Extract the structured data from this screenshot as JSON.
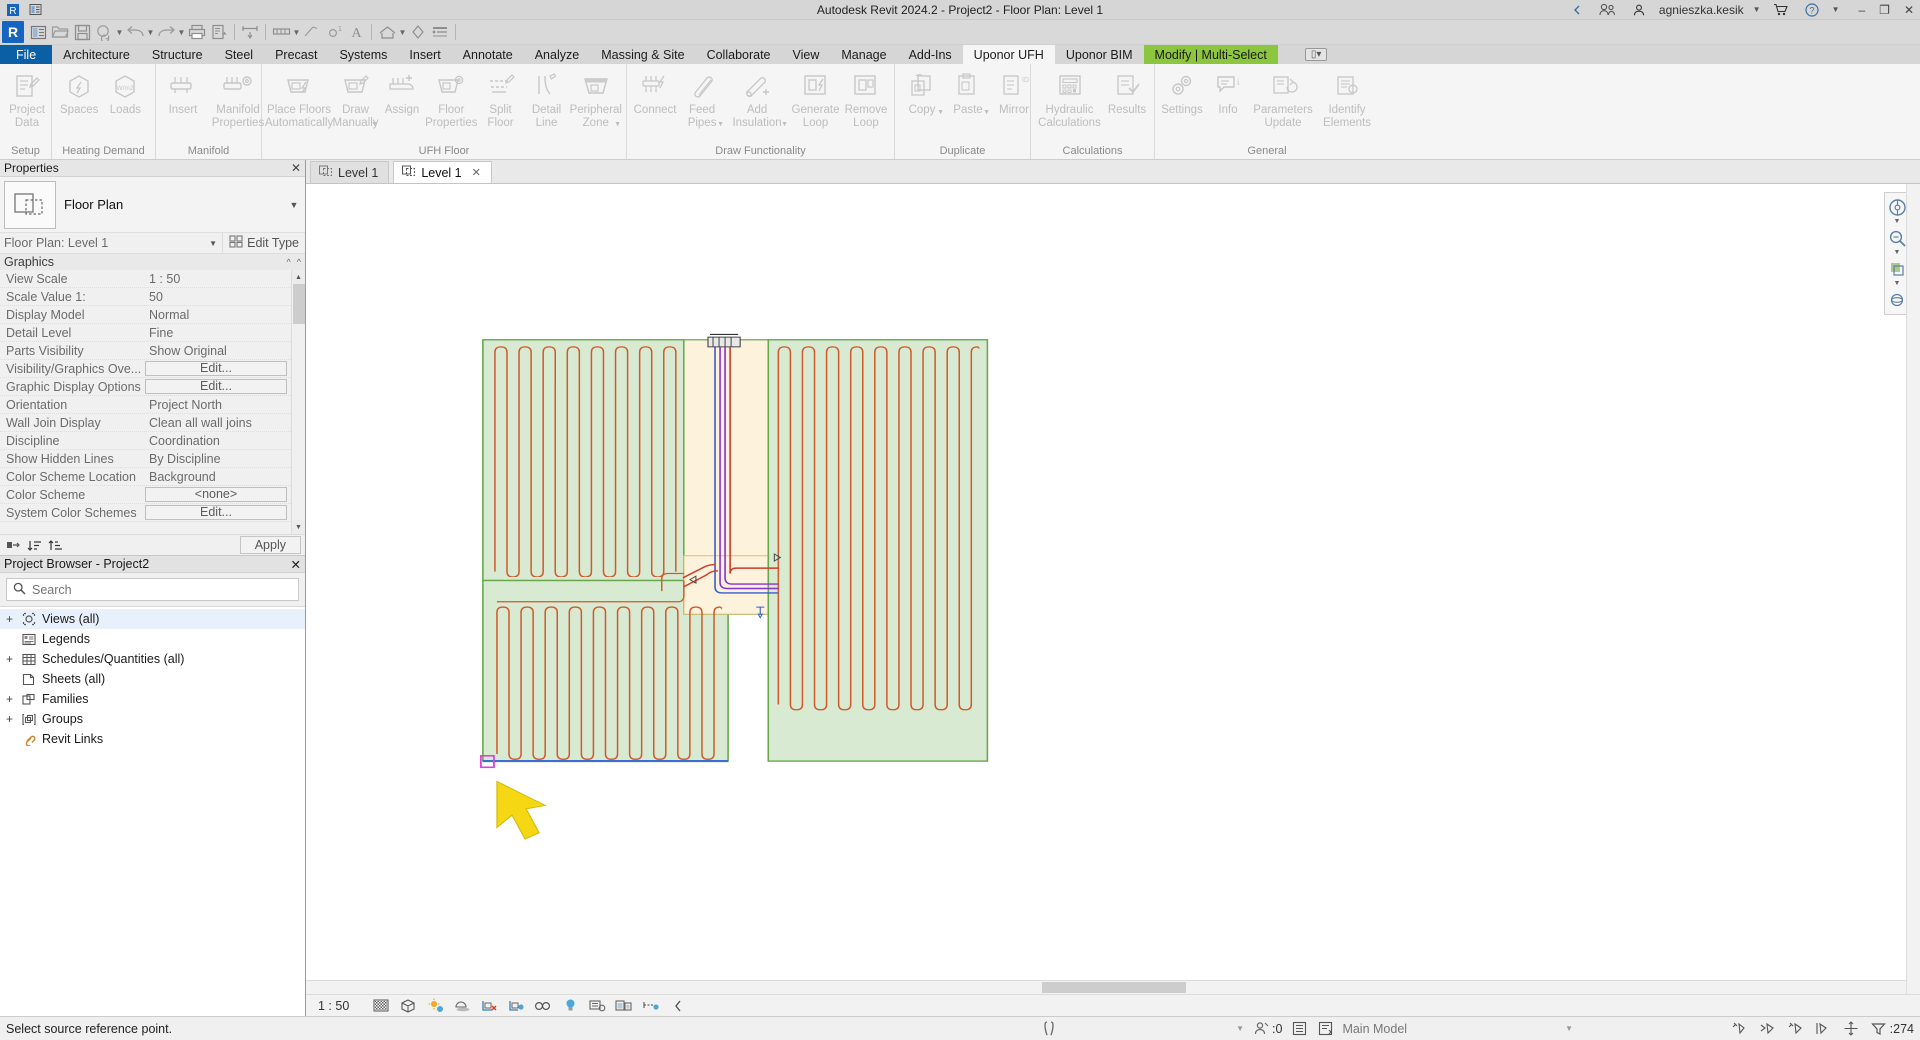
{
  "titlebar": {
    "title": "Autodesk Revit 2024.2 - Project2 - Floor Plan: Level 1",
    "user": "agnieszka.kesik",
    "minimize": "–",
    "maximize": "❐",
    "close": "✕"
  },
  "quick_access": {
    "app_letter": "R",
    "items": [
      "properties-icon",
      "open-icon",
      "save-icon",
      "save-as-cloud-icon",
      "undo-icon",
      "redo-icon",
      "print-icon",
      "print-preview-icon",
      "measure-icon",
      "aligned-dimension-icon",
      "tag-icon",
      "keynote-icon",
      "text-icon",
      "default-3d-view-icon",
      "section-icon",
      "thin-lines-icon"
    ]
  },
  "ribbon_tabs": [
    {
      "label": "File",
      "style": "file"
    },
    {
      "label": "Architecture",
      "style": ""
    },
    {
      "label": "Structure",
      "style": ""
    },
    {
      "label": "Steel",
      "style": ""
    },
    {
      "label": "Precast",
      "style": ""
    },
    {
      "label": "Systems",
      "style": ""
    },
    {
      "label": "Insert",
      "style": ""
    },
    {
      "label": "Annotate",
      "style": ""
    },
    {
      "label": "Analyze",
      "style": ""
    },
    {
      "label": "Massing & Site",
      "style": ""
    },
    {
      "label": "Collaborate",
      "style": ""
    },
    {
      "label": "View",
      "style": ""
    },
    {
      "label": "Manage",
      "style": ""
    },
    {
      "label": "Add-Ins",
      "style": ""
    },
    {
      "label": "Uponor UFH",
      "style": "active"
    },
    {
      "label": "Uponor BIM",
      "style": ""
    },
    {
      "label": "Modify | Multi-Select",
      "style": "green"
    }
  ],
  "ribbon_panels": [
    {
      "title": "Setup",
      "buttons": [
        {
          "label": "Project\nData",
          "icon": "project-data-icon",
          "dropdown": false
        }
      ]
    },
    {
      "title": "Heating Demand",
      "buttons": [
        {
          "label": "Spaces",
          "icon": "spaces-icon",
          "dropdown": false
        },
        {
          "label": "Loads",
          "icon": "loads-icon",
          "dropdown": false
        }
      ]
    },
    {
      "title": "Manifold",
      "buttons": [
        {
          "label": "Insert",
          "icon": "insert-manifold-icon",
          "dropdown": false
        },
        {
          "label": "Manifold\nProperties",
          "icon": "manifold-properties-icon",
          "dropdown": false
        }
      ]
    },
    {
      "title": "UFH Floor",
      "buttons": [
        {
          "label": "Place Floors\nAutomatically",
          "icon": "place-floors-icon",
          "dropdown": false
        },
        {
          "label": "Draw\nManually",
          "icon": "draw-manually-icon",
          "dropdown": true
        },
        {
          "label": "Assign",
          "icon": "assign-icon",
          "dropdown": false
        },
        {
          "label": "Floor\nProperties",
          "icon": "floor-properties-icon",
          "dropdown": false
        },
        {
          "label": "Split\nFloor",
          "icon": "split-floor-icon",
          "dropdown": false
        },
        {
          "label": "Detail\nLine",
          "icon": "detail-line-icon",
          "dropdown": false
        },
        {
          "label": "Peripheral\nZone",
          "icon": "peripheral-zone-icon",
          "dropdown": true
        }
      ]
    },
    {
      "title": "Draw Functionality",
      "buttons": [
        {
          "label": "Connect",
          "icon": "connect-icon",
          "dropdown": false
        },
        {
          "label": "Feed\nPipes",
          "icon": "feed-pipes-icon",
          "dropdown": true
        },
        {
          "label": "Add\nInsulation",
          "icon": "add-insulation-icon",
          "dropdown": true
        },
        {
          "label": "Generate\nLoop",
          "icon": "generate-loop-icon",
          "dropdown": false
        },
        {
          "label": "Remove\nLoop",
          "icon": "remove-loop-icon",
          "dropdown": false
        }
      ]
    },
    {
      "title": "Duplicate",
      "buttons": [
        {
          "label": "Copy",
          "icon": "copy-icon",
          "dropdown": true
        },
        {
          "label": "Paste",
          "icon": "paste-icon",
          "dropdown": true
        },
        {
          "label": "Mirror",
          "icon": "mirror-icon",
          "dropdown": false
        }
      ]
    },
    {
      "title": "Calculations",
      "buttons": [
        {
          "label": "Hydraulic\nCalculations",
          "icon": "hydraulic-calculations-icon",
          "dropdown": false
        },
        {
          "label": "Results",
          "icon": "results-icon",
          "dropdown": false
        }
      ]
    },
    {
      "title": "General",
      "buttons": [
        {
          "label": "Settings",
          "icon": "settings-icon",
          "dropdown": false
        },
        {
          "label": "Info",
          "icon": "info-icon",
          "dropdown": false
        },
        {
          "label": "Parameters\nUpdate",
          "icon": "parameters-update-icon",
          "dropdown": false
        },
        {
          "label": "Identify\nElements",
          "icon": "identify-elements-icon",
          "dropdown": false
        }
      ]
    }
  ],
  "properties": {
    "title": "Properties",
    "close": "✕",
    "type_name": "Floor Plan",
    "selector_value": "Floor Plan: Level 1",
    "edit_type_label": "Edit Type",
    "group_label": "Graphics",
    "apply_label": "Apply",
    "rows": [
      {
        "key": "View Scale",
        "value": "1 : 50",
        "button": false
      },
      {
        "key": "Scale Value    1:",
        "value": "50",
        "button": false
      },
      {
        "key": "Display Model",
        "value": "Normal",
        "button": false
      },
      {
        "key": "Detail Level",
        "value": "Fine",
        "button": false
      },
      {
        "key": "Parts Visibility",
        "value": "Show Original",
        "button": false
      },
      {
        "key": "Visibility/Graphics Ove...",
        "value": "Edit...",
        "button": true
      },
      {
        "key": "Graphic Display Options",
        "value": "Edit...",
        "button": true
      },
      {
        "key": "Orientation",
        "value": "Project North",
        "button": false
      },
      {
        "key": "Wall Join Display",
        "value": "Clean all wall joins",
        "button": false
      },
      {
        "key": "Discipline",
        "value": "Coordination",
        "button": false
      },
      {
        "key": "Show Hidden Lines",
        "value": "By Discipline",
        "button": false
      },
      {
        "key": "Color Scheme Location",
        "value": "Background",
        "button": false
      },
      {
        "key": "Color Scheme",
        "value": "<none>",
        "button": true
      },
      {
        "key": "System Color Schemes",
        "value": "Edit...",
        "button": true
      }
    ]
  },
  "project_browser": {
    "title": "Project Browser - Project2",
    "close": "✕",
    "search_placeholder": "Search",
    "search_value": "",
    "nodes": [
      {
        "label": "Views (all)",
        "expander": "+",
        "icon": "views-icon",
        "selected": true
      },
      {
        "label": "Legends",
        "expander": "",
        "icon": "legends-icon",
        "selected": false
      },
      {
        "label": "Schedules/Quantities (all)",
        "expander": "+",
        "icon": "schedules-icon",
        "selected": false
      },
      {
        "label": "Sheets (all)",
        "expander": "",
        "icon": "sheets-icon",
        "selected": false
      },
      {
        "label": "Families",
        "expander": "+",
        "icon": "families-icon",
        "selected": false
      },
      {
        "label": "Groups",
        "expander": "+",
        "icon": "groups-icon",
        "selected": false
      },
      {
        "label": "Revit Links",
        "expander": "",
        "icon": "revit-links-icon",
        "selected": false
      }
    ]
  },
  "view_tabs": [
    {
      "label": "Level 1",
      "active": false,
      "close": ""
    },
    {
      "label": "Level 1",
      "active": true,
      "close": "✕"
    }
  ],
  "view_control_bar": {
    "scale": "1 : 50",
    "icons": [
      "detail-level-icon",
      "visual-style-icon",
      "sun-path-icon",
      "shadows-icon",
      "render-dialog-icon",
      "crop-view-icon",
      "show-crop-icon",
      "analytical-model-icon",
      "hide-isolate-icon",
      "reveal-hidden-icon",
      "temporary-view-icon",
      "constraints-icon",
      "chevron-left-icon"
    ]
  },
  "status_bar": {
    "message": "Select source reference point.",
    "worksets_count": ":0",
    "model": "Main Model",
    "selection_count": ":274",
    "right_icons": [
      "filter-icon",
      "select-links-icon",
      "select-underlay-icon",
      "select-pinned-icon",
      "select-face-icon",
      "drag-elements-icon",
      "filter-funnel-icon"
    ]
  },
  "canvas": {
    "floor_fill": "#d9ead3",
    "floor_stroke": "#6aa84f",
    "pipe_color": "#d05a2a",
    "manifold_zone_fill": "#fdf3dc",
    "feed_pipe_red": "#d03a2a",
    "feed_pipe_blue": "#3a5cd0",
    "feed_pipe_purple": "#8833cc",
    "selection_box": "#e040e0",
    "arrow_color": "#f5d813",
    "bottom_edge_blue": "#3a6ed0"
  },
  "colors": {
    "accent_blue": "#0b5fa5",
    "modify_green": "#8cc63e",
    "ribbon_bg": "#f5f5f5",
    "title_bg": "#d6d6d6"
  }
}
